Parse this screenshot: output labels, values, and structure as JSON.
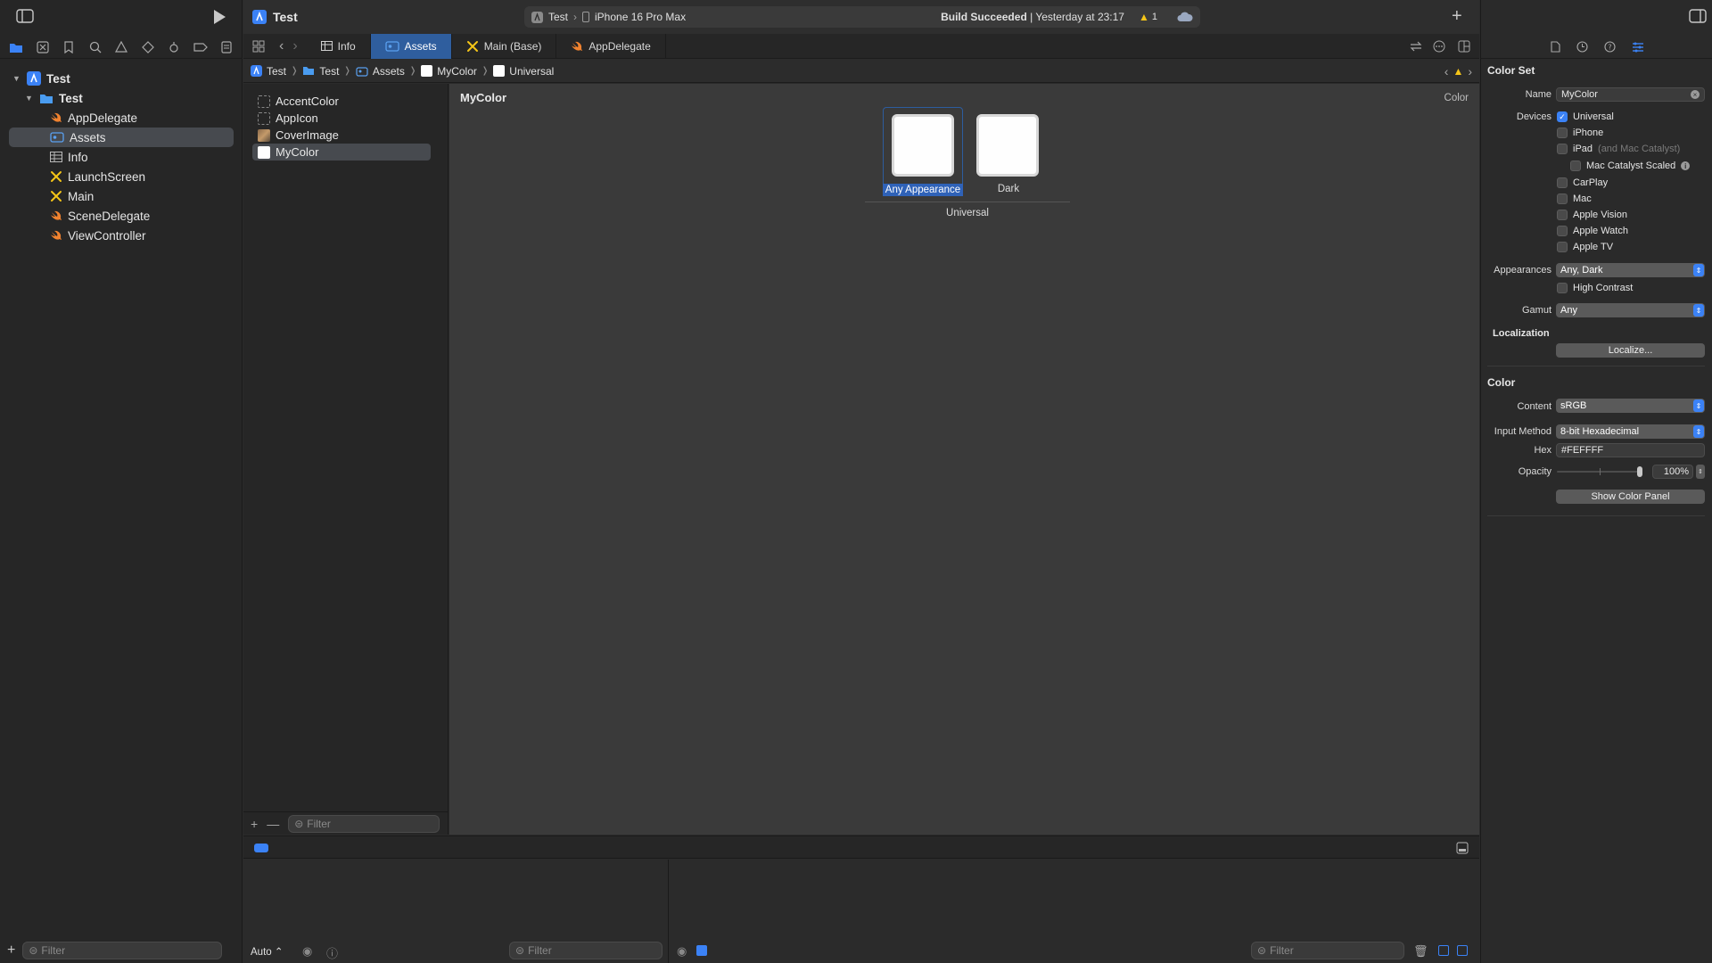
{
  "navigator": {
    "root": "Test",
    "group": "Test",
    "items": [
      {
        "label": "AppDelegate",
        "icon": "swift-file-icon"
      },
      {
        "label": "Assets",
        "icon": "asset-catalog-icon"
      },
      {
        "label": "Info",
        "icon": "plist-icon"
      },
      {
        "label": "LaunchScreen",
        "icon": "storyboard-icon"
      },
      {
        "label": "Main",
        "icon": "storyboard-icon"
      },
      {
        "label": "SceneDelegate",
        "icon": "swift-file-icon"
      },
      {
        "label": "ViewController",
        "icon": "swift-file-icon"
      }
    ],
    "filter_placeholder": "Filter"
  },
  "toolbar": {
    "project_title": "Test",
    "scheme": "Test",
    "destination": "iPhone 16 Pro Max",
    "status_bold": "Build Succeeded",
    "status_rest": " | Yesterday at 23:17",
    "warning_count": "1"
  },
  "tabs": [
    {
      "label": "Info",
      "icon": "table-icon"
    },
    {
      "label": "Assets",
      "icon": "asset-catalog-icon",
      "active": true
    },
    {
      "label": "Main (Base)",
      "icon": "storyboard-icon"
    },
    {
      "label": "AppDelegate",
      "icon": "swift-file-icon"
    }
  ],
  "jumpbar": [
    "Test",
    "Test",
    "Assets",
    "MyColor",
    "Universal"
  ],
  "assets": {
    "items": [
      {
        "label": "AccentColor",
        "swatch": "empty"
      },
      {
        "label": "AppIcon",
        "swatch": "empty"
      },
      {
        "label": "CoverImage",
        "swatch": "image"
      },
      {
        "label": "MyColor",
        "swatch": "white"
      }
    ],
    "filter_placeholder": "Filter"
  },
  "canvas": {
    "title": "MyColor",
    "kind": "Color",
    "wells": [
      {
        "label": "Any Appearance",
        "selected": true
      },
      {
        "label": "Dark",
        "selected": false
      }
    ],
    "group_label": "Universal",
    "color_hex": "#FEFEFE"
  },
  "debug": {
    "auto_label": "Auto",
    "filter_left": "Filter",
    "filter_right": "Filter"
  },
  "inspector": {
    "section_title": "Color Set",
    "name_label": "Name",
    "name_value": "MyColor",
    "devices_label": "Devices",
    "devices": [
      {
        "label": "Universal",
        "checked": true
      },
      {
        "label": "iPhone",
        "checked": false
      },
      {
        "label": "iPad",
        "suffix": "(and Mac Catalyst)",
        "checked": false
      },
      {
        "label": "Mac Catalyst Scaled",
        "checked": false
      },
      {
        "label": "CarPlay",
        "checked": false
      },
      {
        "label": "Mac",
        "checked": false
      },
      {
        "label": "Apple Vision",
        "checked": false
      },
      {
        "label": "Apple Watch",
        "checked": false
      },
      {
        "label": "Apple TV",
        "checked": false
      }
    ],
    "appearances_label": "Appearances",
    "appearances_value": "Any, Dark",
    "high_contrast_label": "High Contrast",
    "gamut_label": "Gamut",
    "gamut_value": "Any",
    "localization_label": "Localization",
    "localize_button": "Localize...",
    "color_section": "Color",
    "content_label": "Content",
    "content_value": "sRGB",
    "input_method_label": "Input Method",
    "input_method_value": "8-bit Hexadecimal",
    "hex_label": "Hex",
    "hex_value": "#FEFFFF",
    "opacity_label": "Opacity",
    "opacity_value": "100%",
    "opacity_fraction": 1.0,
    "show_color_panel_button": "Show Color Panel"
  },
  "colors": {
    "accent": "#3b82f6",
    "selection": "#474a4f",
    "warning": "#f5c518",
    "swift": "#f0822f",
    "storyboard": "#f5c518"
  }
}
